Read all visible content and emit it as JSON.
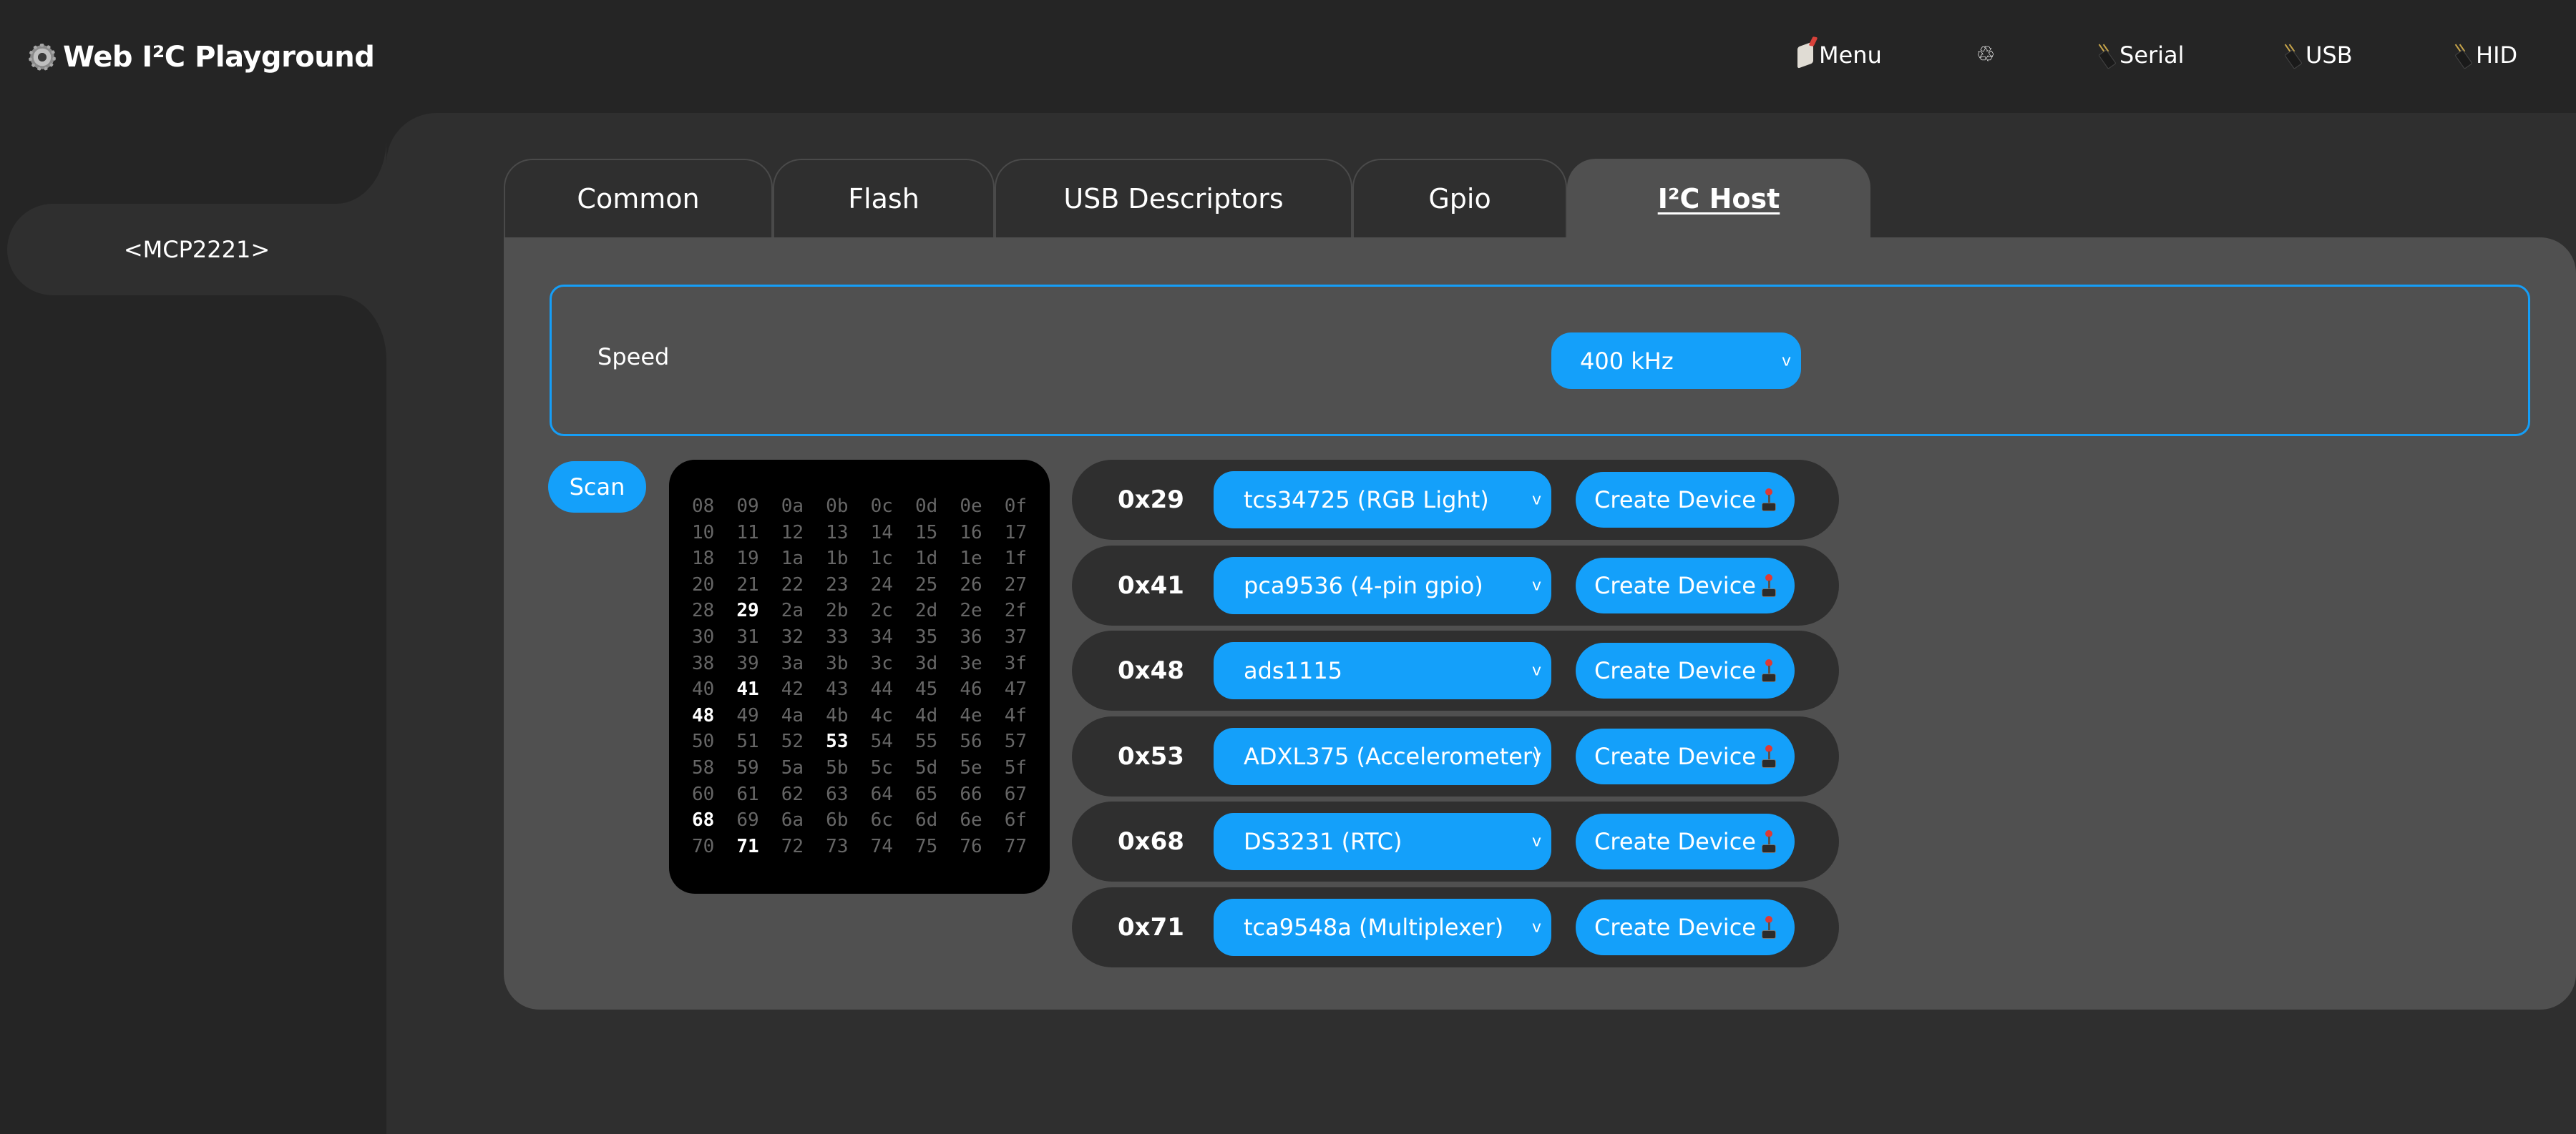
{
  "header": {
    "title": "Web I²C Playground",
    "nav": [
      {
        "label": "Menu",
        "icon": "menu-card-icon"
      },
      {
        "label": "",
        "icon": "recycle-icon"
      },
      {
        "label": "Serial",
        "icon": "plug-icon"
      },
      {
        "label": "USB",
        "icon": "plug-icon"
      },
      {
        "label": "HID",
        "icon": "plug-icon"
      }
    ],
    "recycle_glyph": "♲"
  },
  "sidebar": {
    "items": [
      {
        "label": "<MCP2221>"
      }
    ]
  },
  "tabs": [
    {
      "label": "Common",
      "active": false
    },
    {
      "label": "Flash",
      "active": false
    },
    {
      "label": "USB Descriptors",
      "active": false
    },
    {
      "label": "Gpio",
      "active": false
    },
    {
      "label": "I²C Host",
      "active": true
    }
  ],
  "i2c_host": {
    "speed_label": "Speed",
    "speed_value": "400 kHz",
    "scan_label": "Scan",
    "chevron": "v",
    "hex_grid": {
      "start": "08",
      "end": "77",
      "found": [
        "29",
        "41",
        "48",
        "53",
        "68",
        "71"
      ]
    },
    "devices": [
      {
        "address": "0x29",
        "driver": "tcs34725 (RGB Light)",
        "button": "Create Device"
      },
      {
        "address": "0x41",
        "driver": "pca9536 (4-pin gpio)",
        "button": "Create Device"
      },
      {
        "address": "0x48",
        "driver": "ads1115",
        "button": "Create Device"
      },
      {
        "address": "0x53",
        "driver": "ADXL375 (Accelerometer)",
        "button": "Create Device"
      },
      {
        "address": "0x68",
        "driver": "DS3231 (RTC)",
        "button": "Create Device"
      },
      {
        "address": "0x71",
        "driver": "tca9548a (Multiplexer)",
        "button": "Create Device"
      }
    ]
  },
  "colors": {
    "accent": "#14a0fa",
    "panel": "#505050",
    "surface": "#2f2f2f",
    "background": "#252525"
  }
}
